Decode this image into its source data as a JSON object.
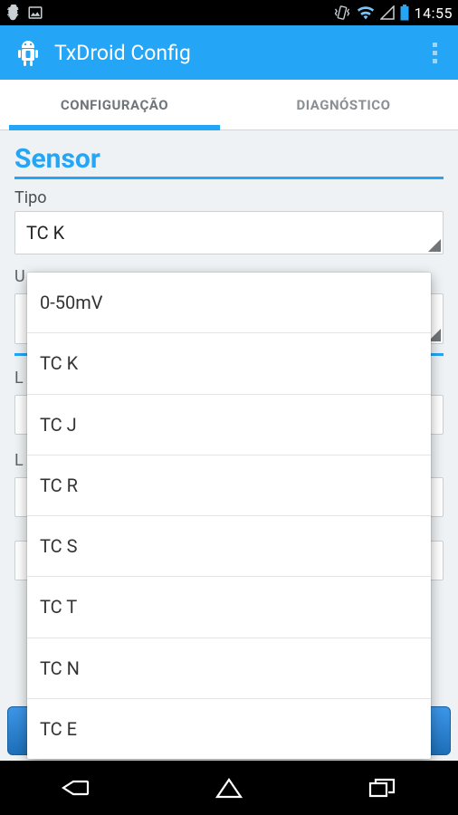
{
  "status": {
    "time": "14:55"
  },
  "header": {
    "title": "TxDroid Config"
  },
  "tabs": [
    {
      "label": "CONFIGURAÇÃO",
      "active": true
    },
    {
      "label": "DIAGNÓSTICO",
      "active": false
    }
  ],
  "section": {
    "title": "Sensor",
    "field_label": "Tipo",
    "field_value": "TC K",
    "bg_u_label": "U",
    "bg_l_label1": "L",
    "bg_l_label2": "L"
  },
  "dropdown": {
    "options": [
      "0-50mV",
      "TC K",
      "TC J",
      "TC R",
      "TC S",
      "TC T",
      "TC N",
      "TC E"
    ]
  },
  "colors": {
    "accent": "#25a5f5"
  }
}
